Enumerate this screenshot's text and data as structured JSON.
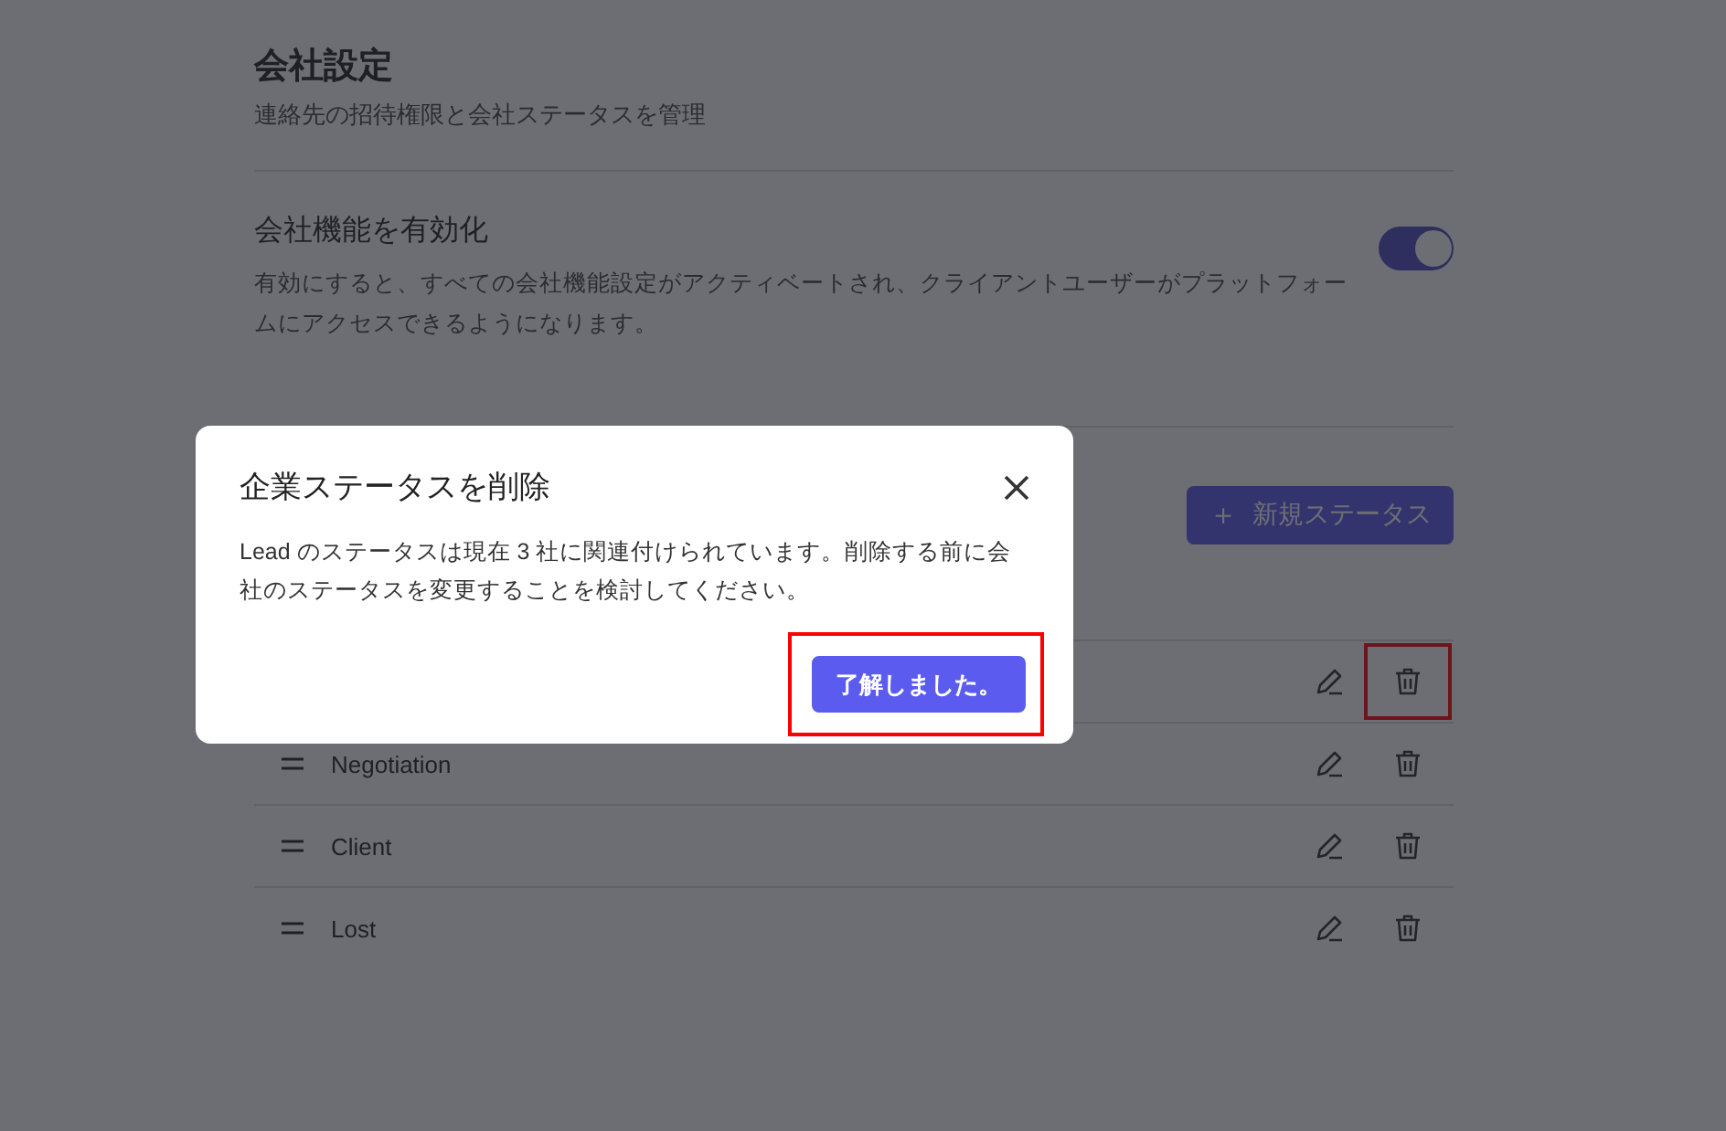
{
  "page": {
    "title": "会社設定",
    "subtitle": "連絡先の招待権限と会社ステータスを管理"
  },
  "feature": {
    "title": "会社機能を有効化",
    "description": "有効にすると、すべての会社機能設定がアクティベートされ、クライアントユーザーがプラットフォームにアクセスできるようになります。",
    "on": true
  },
  "new_status_button": {
    "icon": "＋",
    "label": "新規ステータス"
  },
  "statuses": [
    {
      "highlighted": true
    },
    {
      "name": "Negotiation",
      "highlighted": false
    },
    {
      "name": "Client",
      "highlighted": false
    },
    {
      "name": "Lost",
      "highlighted": false
    }
  ],
  "dialog": {
    "title": "企業ステータスを削除",
    "message": "Lead のステータスは現在 3 社に関連付けられています。削除する前に会社のステータスを変更することを検討してください。",
    "confirm_button": "了解しました。",
    "confirm_highlighted": true
  }
}
